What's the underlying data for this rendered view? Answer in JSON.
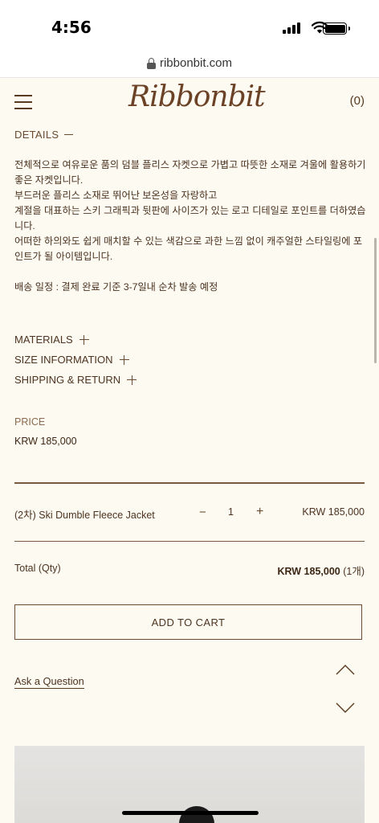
{
  "status_bar": {
    "time": "4:56"
  },
  "browser": {
    "url": "ribbonbit.com"
  },
  "header": {
    "logo": "Ribbonbit",
    "cart_count": "(0)"
  },
  "details": {
    "title": "DETAILS",
    "lines": [
      "전체적으로 여유로운 품의 덤블 플리스 자켓으로 가볍고 따뜻한 소재로 겨울에 활용하기 좋은 자켓입니다.",
      "부드러운 플리스 소재로 뛰어난 보온성을 자랑하고",
      "계절을 대표하는 스키 그래픽과 뒷판에 사이즈가 있는 로고 디테일로 포인트를 더하였습니다.",
      "어떠한 하의와도 쉽게 매치할 수 있는 색감으로 과한 느낌 없이 캐주얼한 스타일링에 포인트가 될 아이템입니다."
    ],
    "shipping_note": "배송 일정 : 결제 완료 기준 3-7일내 순차 발송 예정"
  },
  "accordion": [
    {
      "label": "MATERIALS"
    },
    {
      "label": "SIZE INFORMATION"
    },
    {
      "label": "SHIPPING & RETURN"
    }
  ],
  "price": {
    "label": "PRICE",
    "value": "KRW 185,000"
  },
  "option": {
    "name": "(2차) Ski Dumble Fleece Jacket",
    "minus": "−",
    "quantity": "1",
    "plus": "+",
    "price": "KRW 185,000"
  },
  "total": {
    "label": "Total (Qty)",
    "amount": "KRW 185,000",
    "count": "(1개)"
  },
  "add_to_cart": "ADD TO CART",
  "ask_question": "Ask a Question",
  "icons": {
    "menu": "hamburger-menu-icon",
    "lock": "lock-icon",
    "scroll_up": "chevron-up-icon",
    "scroll_down": "chevron-down-icon"
  },
  "colors": {
    "background": "#fcfaf1",
    "text": "#5a3a1e",
    "accent": "#6b4226"
  }
}
